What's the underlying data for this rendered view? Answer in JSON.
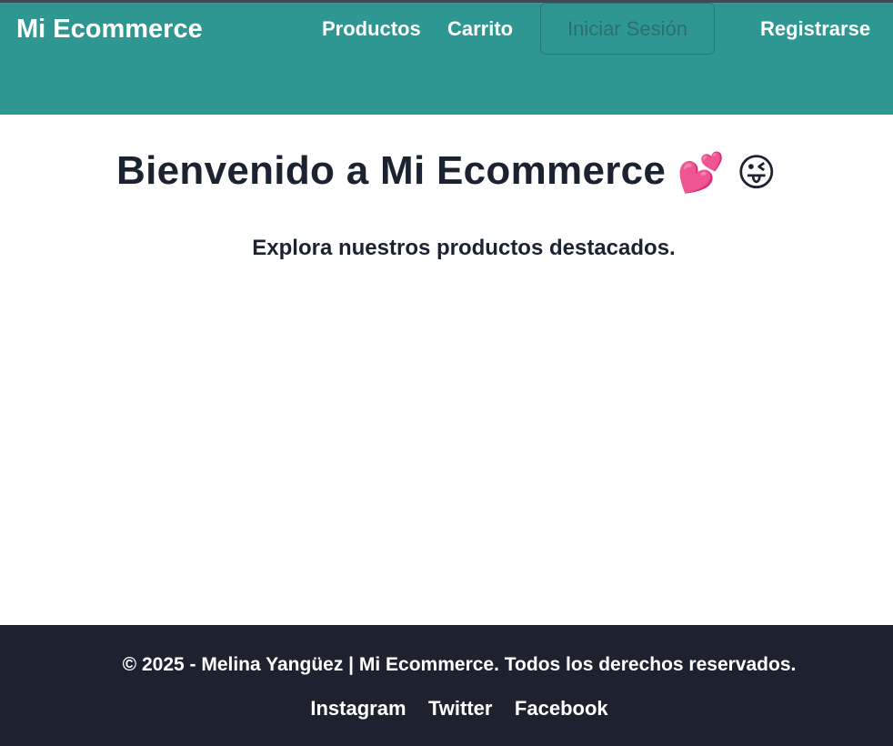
{
  "navbar": {
    "brand": "Mi Ecommerce",
    "links": {
      "productos": "Productos",
      "carrito": "Carrito",
      "login": "Iniciar Sesión",
      "registrarse": "Registrarse"
    }
  },
  "main": {
    "title": "Bienvenido a Mi Ecommerce",
    "title_emojis": [
      "💕",
      "😜"
    ],
    "subtitle": "Explora nuestros productos destacados."
  },
  "footer": {
    "copyright": "© 2025 - Melina Yangüez | Mi Ecommerce. Todos los derechos reservados.",
    "social_links": [
      "Instagram",
      "Twitter",
      "Facebook"
    ]
  },
  "colors": {
    "navbar_bg": "#2f9792",
    "footer_bg": "#1e222f",
    "text_dark": "#1b2330"
  }
}
